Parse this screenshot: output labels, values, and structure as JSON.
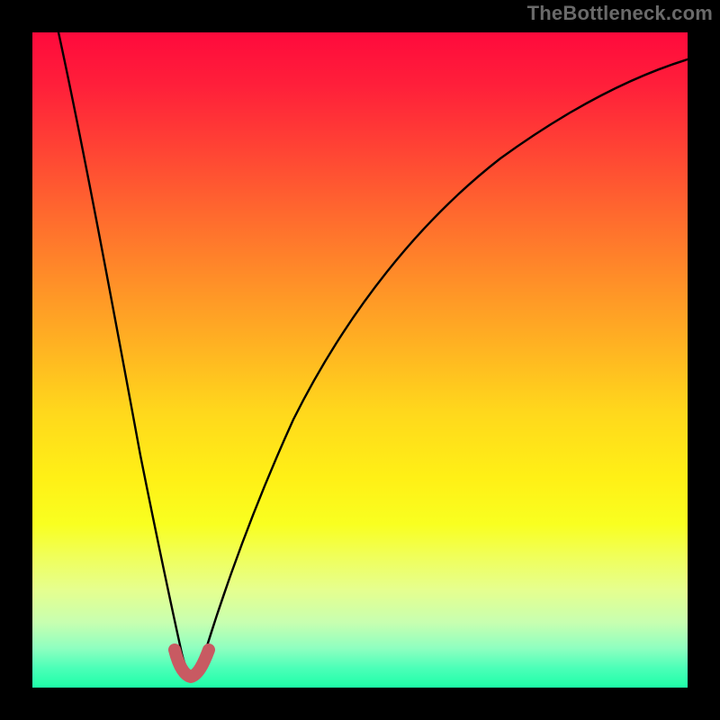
{
  "attribution": "TheBottleneck.com",
  "chart_data": {
    "type": "line",
    "title": "",
    "xlabel": "",
    "ylabel": "",
    "xlim": [
      0,
      100
    ],
    "ylim": [
      0,
      100
    ],
    "series": [
      {
        "name": "bottleneck-curve",
        "x": [
          4,
          6,
          8,
          10,
          12,
          14,
          16,
          18,
          20,
          22,
          23,
          24,
          25,
          26,
          28,
          30,
          33,
          37,
          42,
          48,
          55,
          63,
          72,
          82,
          92,
          100
        ],
        "y": [
          100,
          88,
          76,
          64,
          53,
          42,
          32,
          22,
          13,
          6,
          3,
          2,
          3,
          6,
          13,
          20,
          29,
          38,
          47,
          55,
          62,
          68,
          73,
          77,
          80,
          82
        ]
      },
      {
        "name": "highlight-bottom",
        "x": [
          21.5,
          22.5,
          23.5,
          24.5,
          25.5,
          26.5
        ],
        "y": [
          4.5,
          2.5,
          1.5,
          1.5,
          2.5,
          4.5
        ]
      }
    ],
    "gradient_stops": [
      {
        "pos": 0,
        "color": "#ff0a3c"
      },
      {
        "pos": 18,
        "color": "#ff4434"
      },
      {
        "pos": 38,
        "color": "#ff8f28"
      },
      {
        "pos": 58,
        "color": "#ffd81c"
      },
      {
        "pos": 75,
        "color": "#f9ff20"
      },
      {
        "pos": 90,
        "color": "#c8ffb0"
      },
      {
        "pos": 100,
        "color": "#1effa8"
      }
    ]
  }
}
